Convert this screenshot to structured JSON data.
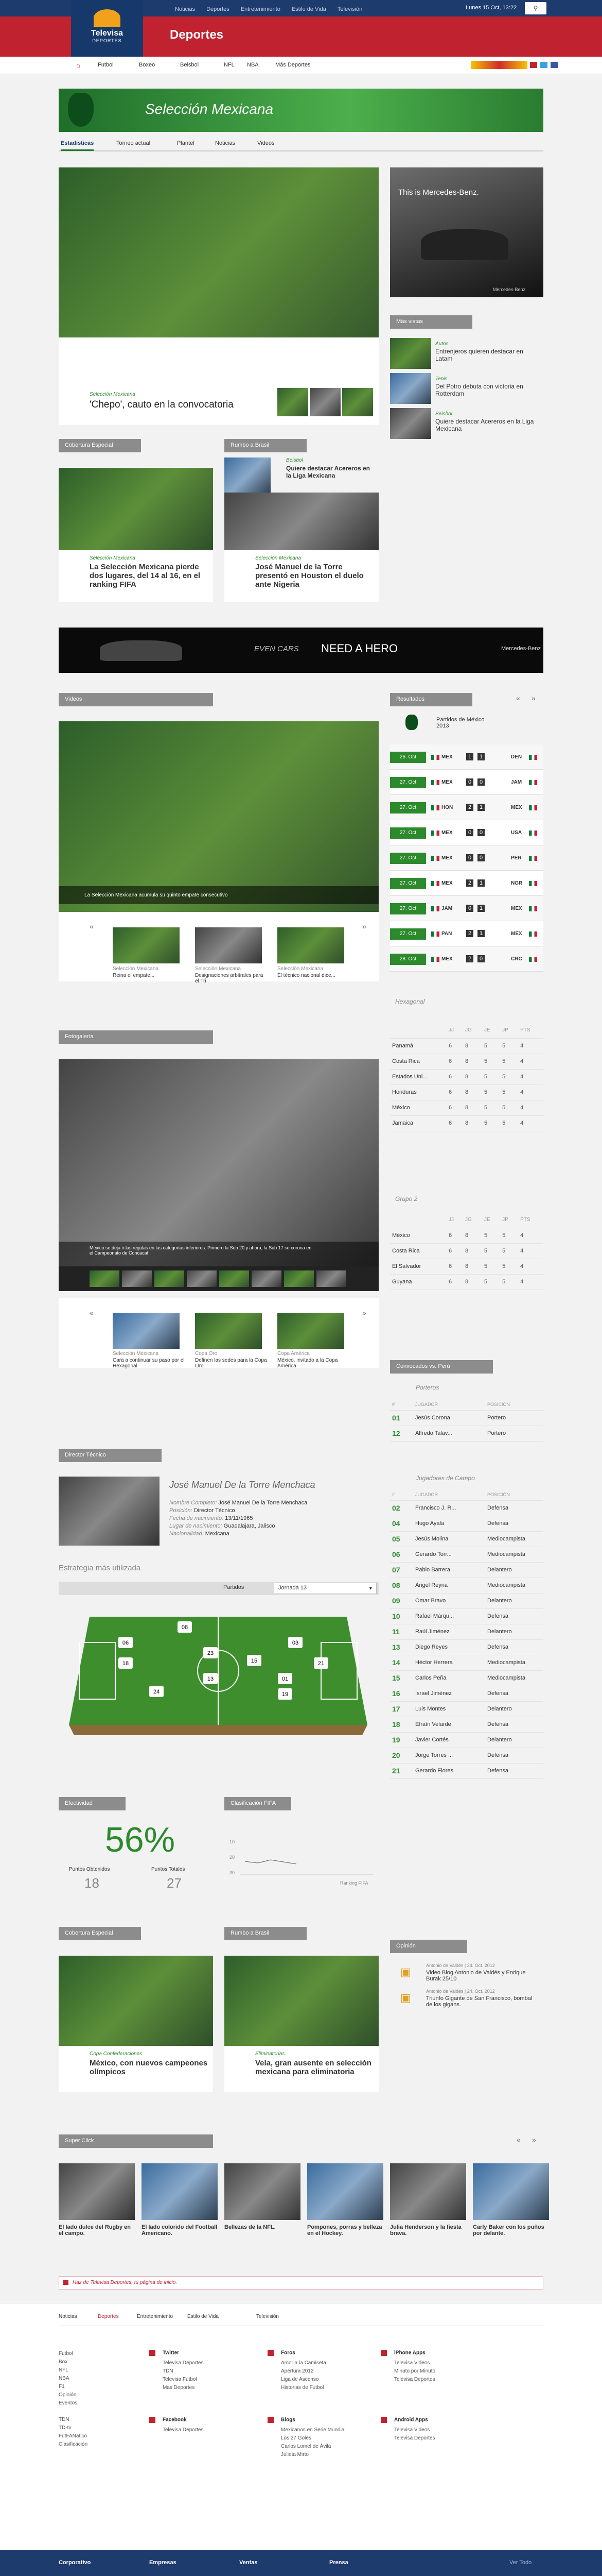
{
  "topnav": {
    "items": [
      "Noticias",
      "Deportes",
      "Entretenimiento",
      "Estilo de Vida",
      "Televisión"
    ],
    "date": "Lunes 15 Oct, 13:22"
  },
  "brand": {
    "logo": "Televisa",
    "logo_sub": "DEPORTES",
    "section": "Deportes"
  },
  "subnav": {
    "items": [
      "Futbol",
      "Boxeo",
      "Beisbol",
      "NFL",
      "NBA",
      "Más Deportes"
    ]
  },
  "hero": {
    "title": "Selección Mexicana",
    "tabs": [
      "Estadísticas",
      "Torneo actual",
      "Plantel",
      "Noticias",
      "Videos"
    ]
  },
  "main_story": {
    "category": "Selección Mexicana",
    "headline": "'Chepo', cauto en la convocatoria"
  },
  "ad_side": {
    "text": "This is Mercedes-Benz.",
    "sub": "Mercedes-Benz"
  },
  "mas_vistas": {
    "title": "Más vistas",
    "items": [
      {
        "cat": "Autos",
        "text": "Entrenjeros quieren destacar en Latam"
      },
      {
        "cat": "Tenis",
        "text": "Del Potro debuta con victoria en Rotterdam"
      },
      {
        "cat": "Beisbol",
        "text": "Quiere destacar Acereros en la Liga Mexicana"
      }
    ]
  },
  "cobertura": {
    "title": "Cobertura Especial",
    "cat": "Selección Mexicana",
    "headline": "La Selección Mexicana pierde dos lugares, del 14 al 16, en el ranking FIFA"
  },
  "rumbo": {
    "title": "Rumbo a Brasil",
    "top_cat": "Beisbol",
    "top_text": "Quiere destacar Acereros en la Liga Mexicana",
    "cat": "Selección Mexicana",
    "headline": "José Manuel de la Torre presentó en Houston el duelo ante Nigeria"
  },
  "banner": {
    "brand": "EVEN CARS",
    "text": "NEED A HERO",
    "sub": "Mercedes-Benz"
  },
  "videos": {
    "title": "Videos",
    "caption": "La Selección Mexicana acumula su quinto empate consecutivo",
    "thumbs": [
      {
        "cat": "Selección Mexicana",
        "text": "Reina el empate..."
      },
      {
        "cat": "Selección Mexicana",
        "text": "Designaciones arbitrales para el Tri"
      },
      {
        "cat": "Selección Mexicana",
        "text": "El técnico nacional dice..."
      }
    ]
  },
  "resultados": {
    "title": "Resultados",
    "head": "Partidos de México 2013",
    "rows": [
      {
        "date": "26. Oct",
        "a": "MEX",
        "sa": "1",
        "sb": "1",
        "b": "DEN"
      },
      {
        "date": "27. Oct",
        "a": "MEX",
        "sa": "0",
        "sb": "0",
        "b": "JAM"
      },
      {
        "date": "27. Oct",
        "a": "HON",
        "sa": "2",
        "sb": "1",
        "b": "MEX"
      },
      {
        "date": "27. Oct",
        "a": "MEX",
        "sa": "0",
        "sb": "0",
        "b": "USA"
      },
      {
        "date": "27. Oct",
        "a": "MEX",
        "sa": "0",
        "sb": "0",
        "b": "PER"
      },
      {
        "date": "27. Oct",
        "a": "MEX",
        "sa": "2",
        "sb": "1",
        "b": "NGR"
      },
      {
        "date": "27. Oct",
        "a": "JAM",
        "sa": "0",
        "sb": "1",
        "b": "MEX"
      },
      {
        "date": "27. Oct",
        "a": "PAN",
        "sa": "2",
        "sb": "1",
        "b": "MEX"
      },
      {
        "date": "28. Oct",
        "a": "MEX",
        "sa": "2",
        "sb": "0",
        "b": "CRC"
      }
    ]
  },
  "hexagonal": {
    "title": "Hexagonal",
    "cols": [
      "JJ",
      "JG",
      "JE",
      "JP",
      "PTS"
    ],
    "rows": [
      [
        "Panamá",
        "6",
        "8",
        "5",
        "5",
        "4"
      ],
      [
        "Costa Rica",
        "6",
        "8",
        "5",
        "5",
        "4"
      ],
      [
        "Estados Uni...",
        "6",
        "8",
        "5",
        "5",
        "4"
      ],
      [
        "Honduras",
        "6",
        "8",
        "5",
        "5",
        "4"
      ],
      [
        "México",
        "6",
        "8",
        "5",
        "5",
        "4"
      ],
      [
        "Jamaica",
        "6",
        "8",
        "5",
        "5",
        "4"
      ]
    ]
  },
  "grupo2": {
    "title": "Grupo 2",
    "cols": [
      "JJ",
      "JG",
      "JE",
      "JP",
      "PTS"
    ],
    "rows": [
      [
        "México",
        "6",
        "8",
        "5",
        "5",
        "4"
      ],
      [
        "Costa Rica",
        "6",
        "8",
        "5",
        "5",
        "4"
      ],
      [
        "El Salvador",
        "6",
        "8",
        "5",
        "5",
        "4"
      ],
      [
        "Guyana",
        "6",
        "8",
        "5",
        "5",
        "4"
      ]
    ]
  },
  "fotogaleria": {
    "title": "Fotogalería",
    "caption": "México se deja ir las regulas en las categorías inferiores. Primero la Sub 20 y ahora, la Sub 17 se corona en el Campeonato de Concacaf",
    "thumbs": [
      {
        "cat": "Selección Mexicana",
        "text": "Cara a continuar su paso por el Hexagonal"
      },
      {
        "cat": "Copa Oro",
        "text": "Definen las sedes para la Copa Oro"
      },
      {
        "cat": "Copa América",
        "text": "México, invitado a la Copa América"
      }
    ]
  },
  "convocados": {
    "title": "Convocados vs. Perú",
    "porteros": "Porteros",
    "campo": "Jugadores de Campo",
    "cols": [
      "#",
      "JUGADOR",
      "POSICIÓN"
    ],
    "gk": [
      [
        "01",
        "Jesús Corona",
        "Portero"
      ],
      [
        "12",
        "Alfredo Talav...",
        "Portero"
      ]
    ],
    "players": [
      [
        "02",
        "Francisco J. R...",
        "Defensa"
      ],
      [
        "04",
        "Hugo Ayala",
        "Defensa"
      ],
      [
        "05",
        "Jesús Molina",
        "Mediocampista"
      ],
      [
        "06",
        "Gerardo Torr...",
        "Mediocampista"
      ],
      [
        "07",
        "Pablo Barrera",
        "Delantero"
      ],
      [
        "08",
        "Ángel Reyna",
        "Mediocampista"
      ],
      [
        "09",
        "Omar Bravo",
        "Delantero"
      ],
      [
        "10",
        "Rafael Márqu...",
        "Defensa"
      ],
      [
        "11",
        "Raúl Jiménez",
        "Delantero"
      ],
      [
        "13",
        "Diego Reyes",
        "Defensa"
      ],
      [
        "14",
        "Héctor Herrera",
        "Mediocampista"
      ],
      [
        "15",
        "Carlos Peña",
        "Mediocampista"
      ],
      [
        "16",
        "Israel Jiménez",
        "Defensa"
      ],
      [
        "17",
        "Luis Montes",
        "Delantero"
      ],
      [
        "18",
        "Efraín Velarde",
        "Defensa"
      ],
      [
        "19",
        "Javier Cortés",
        "Delantero"
      ],
      [
        "20",
        "Jorge Torres ...",
        "Defensa"
      ],
      [
        "21",
        "Gerardo Flores",
        "Defensa"
      ]
    ]
  },
  "director": {
    "title": "Director Técnico",
    "name": "José Manuel De la Torre Menchaca",
    "fields": [
      {
        "k": "Nombre Completo:",
        "v": "José Manuel De la Torre Menchaca"
      },
      {
        "k": "Posición:",
        "v": "Director Técnico"
      },
      {
        "k": "Fecha de nacimiento:",
        "v": "13/11/1965"
      },
      {
        "k": "Lugar de nacimiento:",
        "v": "Guadalajara, Jalisco"
      },
      {
        "k": "Nacionalidad:",
        "v": "Mexicana"
      }
    ]
  },
  "estrategia": {
    "title": "Estrategia más utilizada",
    "label": "Partidos",
    "select": "Jornada 13",
    "numbers": [
      "08",
      "06",
      "23",
      "03",
      "18",
      "15",
      "13",
      "01",
      "21",
      "24",
      "19"
    ]
  },
  "efectividad": {
    "title": "Efectividad",
    "percent": "56%",
    "obt_label": "Puntos Obtenidos",
    "obt": "18",
    "tot_label": "Puntos Totales",
    "tot": "27"
  },
  "fifa": {
    "title": "Clasificación FIFA",
    "y": [
      "10",
      "20",
      "30"
    ],
    "xlabel": "Ranking FIFA"
  },
  "opinion": {
    "title": "Opinión",
    "items": [
      {
        "meta": "Antonio de Valdés | 24. Oct. 2012",
        "text": "Video Blog Antonio de Valdés y Enrique Burak 25/10"
      },
      {
        "meta": "Antonio de Valdés | 24. Oct. 2012",
        "text": "Triunfo Gigante de San Francisco, bombal de los gigans."
      }
    ]
  },
  "cob2": {
    "title": "Cobertura Especial",
    "cat": "Copa Confederaciones",
    "headline": "México, con nuevos campeones olímpicos"
  },
  "rumbo2": {
    "title": "Rumbo a Brasil",
    "cat": "Eliminatorias",
    "headline": "Vela, gran ausente en selección mexicana para eliminatoria"
  },
  "superclick": {
    "title": "Super Click",
    "items": [
      "El lado dulce del Rugby en el campo.",
      "El lado colorido del Football Americano.",
      "Bellezas de la NFL.",
      "Pompones, porras y belleza en el Hockey.",
      "Julia Henderson y la fiesta brava.",
      "Carly Baker con los puños por delante."
    ]
  },
  "homepage": {
    "text": "Haz de Televisa Deportes, tu página de inicio."
  },
  "footer": {
    "tabs": [
      "Noticias",
      "Deportes",
      "Entretenimiento",
      "Estilo de Vida",
      "Televisión"
    ],
    "col1": [
      "Futbol",
      "Box",
      "NFL",
      "NBA",
      "F1",
      "Opinión",
      "Eventos",
      "",
      "TDN",
      "TD-tv",
      "FutFANatico",
      "Clasificación"
    ],
    "twitter": {
      "t": "Twitter",
      "l": [
        "Televisa Deportes",
        "TDN",
        "Televisa Futbol",
        "Mas Deportes"
      ]
    },
    "foros": {
      "t": "Foros",
      "l": [
        "Amor a la Camiseta",
        "Apertura 2012",
        "Liga de Ascenso",
        "Historias de Futbol"
      ]
    },
    "iphone": {
      "t": "iPhone Apps",
      "l": [
        "Televisa Videos",
        "Minuto por Minuto",
        "Televisa Deportes"
      ]
    },
    "facebook": {
      "t": "Facebook",
      "l": [
        "Televisa Deportes"
      ]
    },
    "blogs": {
      "t": "Blogs",
      "l": [
        "Mexicanos en Serie Mundial",
        "Los 27 Goles",
        "Carlos Lomel de Ávila",
        "Julieta Mirto"
      ]
    },
    "android": {
      "t": "Android Apps",
      "l": [
        "Televisa Videos",
        "Televisa Deportes"
      ]
    }
  },
  "bottombar": {
    "items": [
      "Corporativo",
      "Empresas",
      "Ventas",
      "Prensa",
      "Ver Todo"
    ]
  }
}
